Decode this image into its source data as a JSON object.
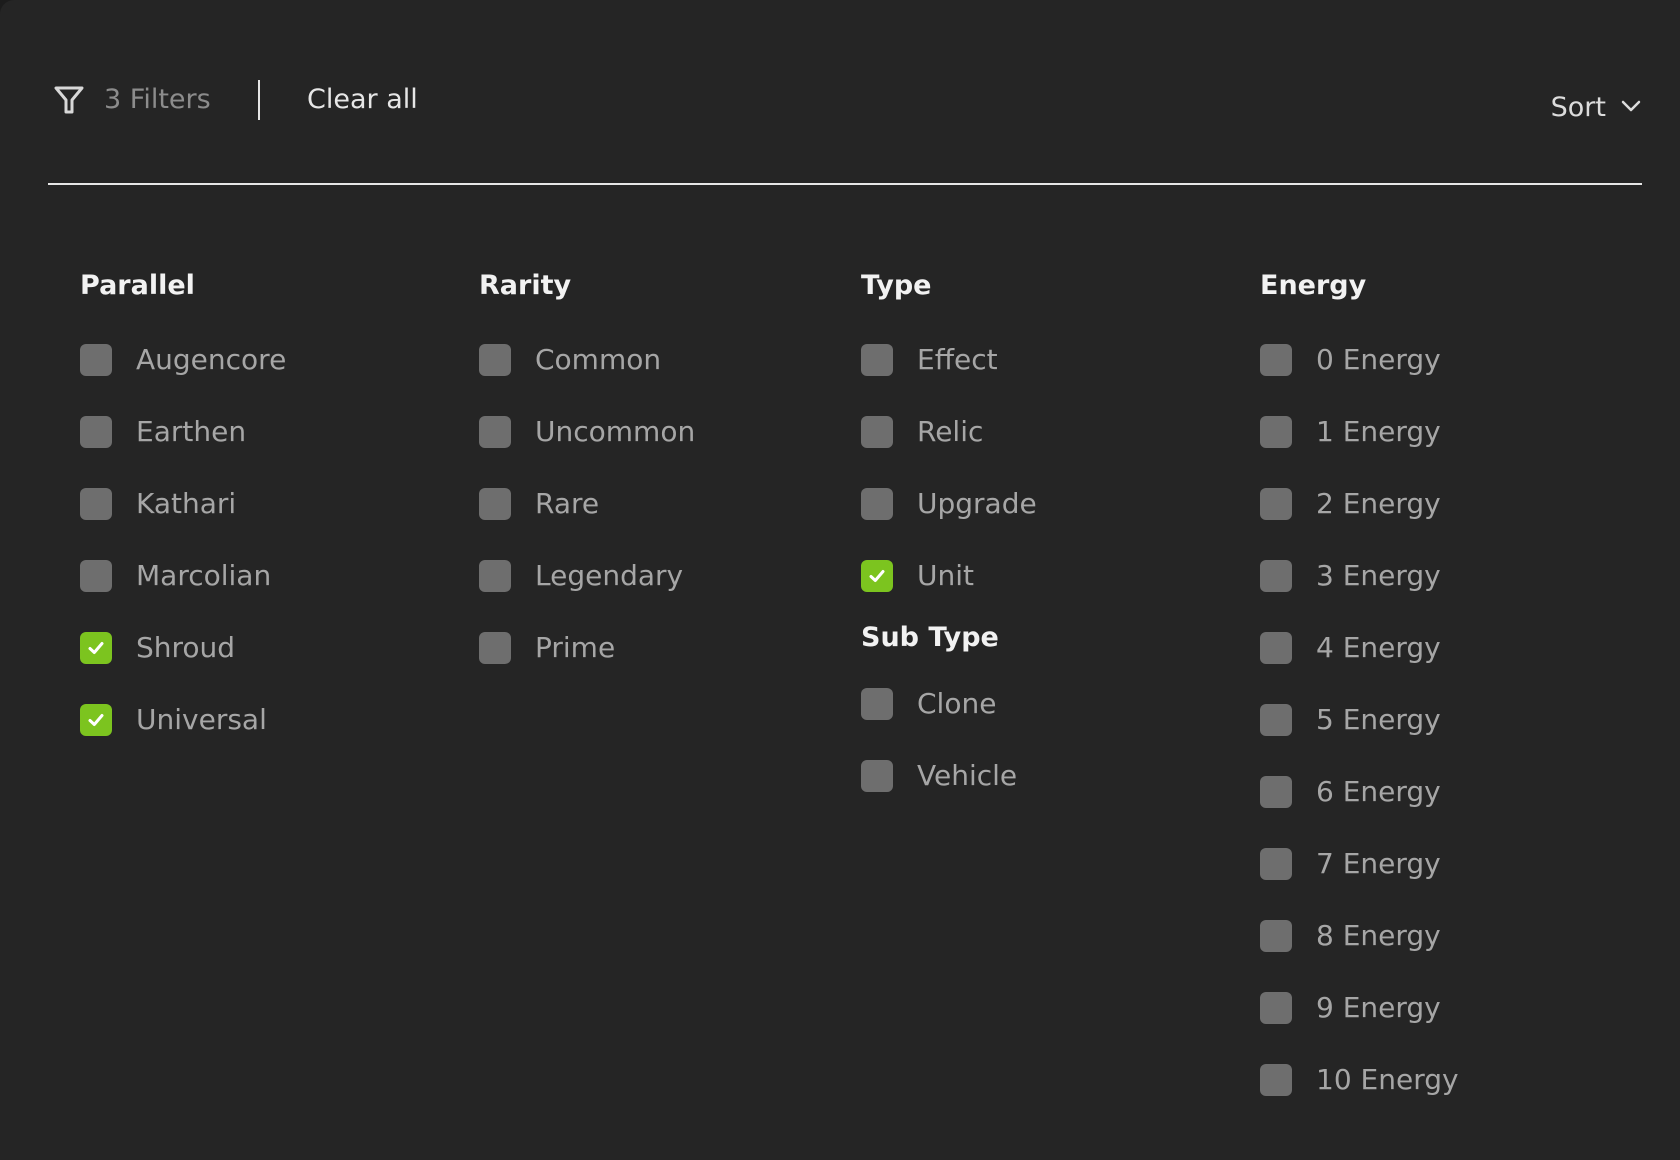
{
  "header": {
    "filter_count": "3 Filters",
    "clear_all": "Clear all",
    "sort_label": "Sort"
  },
  "colors": {
    "background": "#252525",
    "checked": "#7cc41f",
    "unchecked": "#6e6e6e"
  },
  "groups": {
    "parallel": {
      "title": "Parallel",
      "options": [
        {
          "label": "Augencore",
          "checked": false
        },
        {
          "label": "Earthen",
          "checked": false
        },
        {
          "label": "Kathari",
          "checked": false
        },
        {
          "label": "Marcolian",
          "checked": false
        },
        {
          "label": "Shroud",
          "checked": true
        },
        {
          "label": "Universal",
          "checked": true
        }
      ]
    },
    "rarity": {
      "title": "Rarity",
      "options": [
        {
          "label": "Common",
          "checked": false
        },
        {
          "label": "Uncommon",
          "checked": false
        },
        {
          "label": "Rare",
          "checked": false
        },
        {
          "label": "Legendary",
          "checked": false
        },
        {
          "label": "Prime",
          "checked": false
        }
      ]
    },
    "type": {
      "title": "Type",
      "options": [
        {
          "label": "Effect",
          "checked": false
        },
        {
          "label": "Relic",
          "checked": false
        },
        {
          "label": "Upgrade",
          "checked": false
        },
        {
          "label": "Unit",
          "checked": true
        }
      ]
    },
    "sub_type": {
      "title": "Sub Type",
      "options": [
        {
          "label": "Clone",
          "checked": false
        },
        {
          "label": "Vehicle",
          "checked": false
        }
      ]
    },
    "energy": {
      "title": "Energy",
      "options": [
        {
          "label": "0 Energy",
          "checked": false
        },
        {
          "label": "1 Energy",
          "checked": false
        },
        {
          "label": "2 Energy",
          "checked": false
        },
        {
          "label": "3 Energy",
          "checked": false
        },
        {
          "label": "4 Energy",
          "checked": false
        },
        {
          "label": "5 Energy",
          "checked": false
        },
        {
          "label": "6 Energy",
          "checked": false
        },
        {
          "label": "7 Energy",
          "checked": false
        },
        {
          "label": "8 Energy",
          "checked": false
        },
        {
          "label": "9 Energy",
          "checked": false
        },
        {
          "label": "10 Energy",
          "checked": false
        }
      ]
    }
  }
}
